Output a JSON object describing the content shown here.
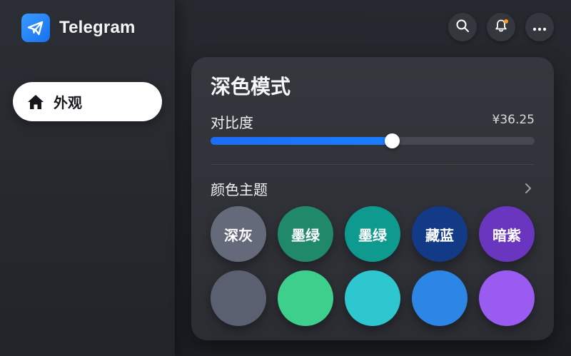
{
  "app": {
    "title": "Telegram"
  },
  "sidebar": {
    "items": [
      {
        "label": "外观",
        "icon": "home-icon",
        "active": true
      }
    ]
  },
  "header": {
    "buttons": [
      {
        "icon": "search-icon"
      },
      {
        "icon": "bell-icon",
        "badge_color": "#ff9a1f"
      },
      {
        "icon": "more-horizontal-icon"
      }
    ]
  },
  "panel": {
    "title": "深色模式",
    "contrast": {
      "label": "对比度",
      "value_text": "¥36.25",
      "level": 0.56
    },
    "themes": {
      "label": "颜色主题",
      "swatches": [
        {
          "label": "深灰",
          "color": "#646a79"
        },
        {
          "label": "墨绿",
          "color": "#20896a"
        },
        {
          "label": "墨绿",
          "color": "#0f9a90"
        },
        {
          "label": "藏蓝",
          "color": "#123a86"
        },
        {
          "label": "暗紫",
          "color": "#6a35bf"
        },
        {
          "label": "",
          "color": "#5b6070"
        },
        {
          "label": "",
          "color": "#3fcf8c"
        },
        {
          "label": "",
          "color": "#2fc7cf"
        },
        {
          "label": "",
          "color": "#2d86e6"
        },
        {
          "label": "",
          "color": "#9a5cf0"
        }
      ]
    }
  },
  "colors": {
    "accent": "#1b74f8",
    "panel_bg": "#303238",
    "app_bg": "#22252a"
  }
}
